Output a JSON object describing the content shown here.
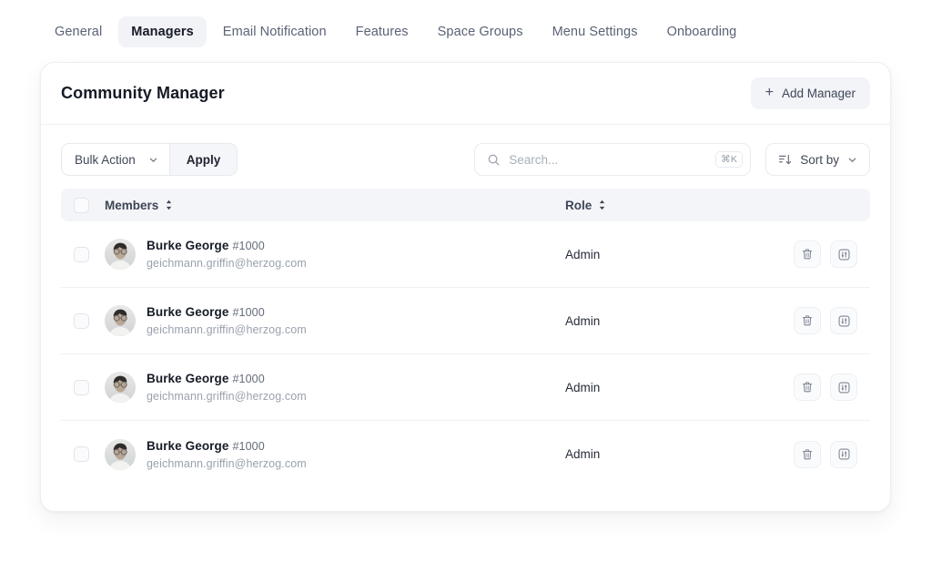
{
  "tabs": [
    {
      "label": "General",
      "active": false
    },
    {
      "label": "Managers",
      "active": true
    },
    {
      "label": "Email Notification",
      "active": false
    },
    {
      "label": "Features",
      "active": false
    },
    {
      "label": "Space Groups",
      "active": false
    },
    {
      "label": "Menu Settings",
      "active": false
    },
    {
      "label": "Onboarding",
      "active": false
    }
  ],
  "card": {
    "title": "Community Manager",
    "add_button": "Add Manager",
    "add_icon": "plus-icon"
  },
  "toolbar": {
    "bulk_action_label": "Bulk Action",
    "bulk_action_icon": "chevron-down-icon",
    "apply_label": "Apply",
    "search_placeholder": "Search...",
    "search_value": "",
    "search_icon": "search-icon",
    "search_shortcut": "⌘K",
    "sort_label": "Sort by",
    "sort_icon": "sort-descending-icon",
    "sort_caret_icon": "chevron-down-icon"
  },
  "table": {
    "columns": {
      "members": "Members",
      "role": "Role",
      "sort_icon": "sort-updown-icon"
    },
    "row_actions": {
      "delete_icon": "trash-icon",
      "settings_icon": "sliders-icon"
    },
    "rows": [
      {
        "name": "Burke George",
        "uid": "#1000",
        "email": "geichmann.griffin@herzog.com",
        "role": "Admin",
        "avatar": "user-photo"
      },
      {
        "name": "Burke George",
        "uid": "#1000",
        "email": "geichmann.griffin@herzog.com",
        "role": "Admin",
        "avatar": "user-photo"
      },
      {
        "name": "Burke George",
        "uid": "#1000",
        "email": "geichmann.griffin@herzog.com",
        "role": "Admin",
        "avatar": "user-photo"
      },
      {
        "name": "Burke George",
        "uid": "#1000",
        "email": "geichmann.griffin@herzog.com",
        "role": "Admin",
        "avatar": "user-photo"
      }
    ]
  },
  "colors": {
    "page_background": "#ffffff",
    "card_border": "#eceef3",
    "tab_active_background": "#f2f3f7",
    "table_header_background": "#f4f5f9",
    "text_primary": "#161b26",
    "text_muted": "#9aa1ad"
  }
}
